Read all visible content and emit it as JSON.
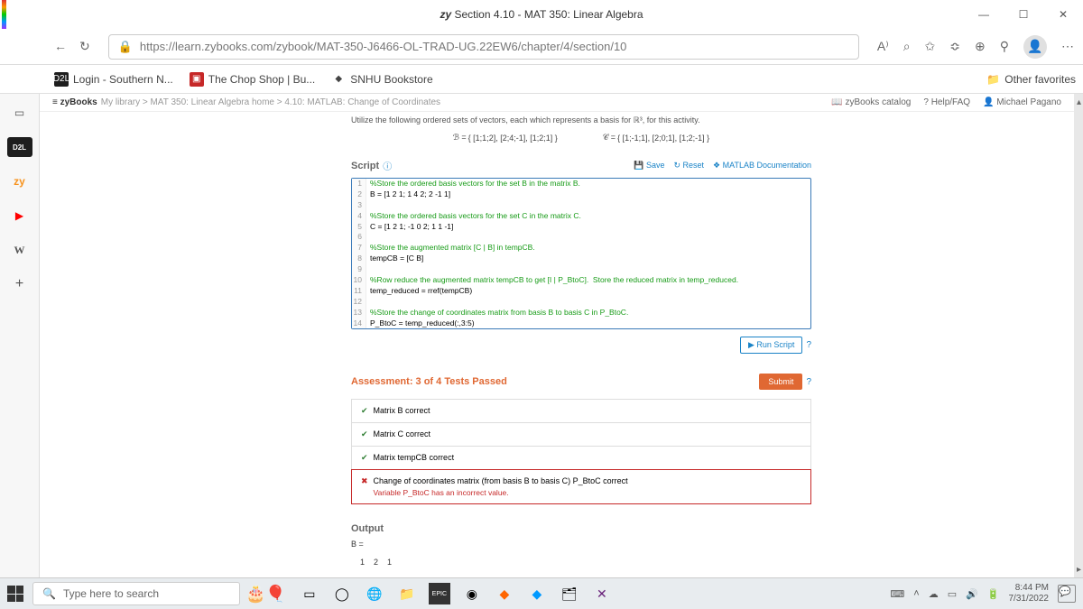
{
  "window": {
    "title_prefix": "zy",
    "title": "Section 4.10 - MAT 350: Linear Algebra"
  },
  "url": "https://learn.zybooks.com/zybook/MAT-350-J6466-OL-TRAD-UG.22EW6/chapter/4/section/10",
  "bookmarks": {
    "items": [
      {
        "label": "Login - Southern N..."
      },
      {
        "label": "The Chop Shop | Bu..."
      },
      {
        "label": "SNHU Bookstore"
      }
    ],
    "other": "Other favorites"
  },
  "zyheader": {
    "brand": "≡ zyBooks",
    "crumb": "My library > MAT 350: Linear Algebra home > 4.10: MATLAB: Change of Coordinates",
    "catalog": "zyBooks catalog",
    "help": "Help/FAQ",
    "user": "Michael Pagano"
  },
  "instruction": "Utilize the following ordered sets of vectors, each which represents a basis for ℝ³, for this activity.",
  "basis": {
    "b_label": "ℬ =",
    "b_vectors": "{ [1;1;2], [2;4;-1], [1;2;1] }",
    "c_label": "𝒞 =",
    "c_vectors": "{ [1;-1;1], [2;0;1], [1;2;-1] }"
  },
  "script": {
    "title": "Script",
    "save": "Save",
    "reset": "Reset",
    "docs": "MATLAB Documentation",
    "run": "Run Script",
    "lines": [
      {
        "n": "1",
        "cls": "code-comment",
        "t": "%Store the ordered basis vectors for the set B in the matrix B."
      },
      {
        "n": "2",
        "cls": "code-normal",
        "t": "B = [1 2 1; 1 4 2; 2 -1 1]"
      },
      {
        "n": "3",
        "cls": "code-normal",
        "t": ""
      },
      {
        "n": "4",
        "cls": "code-comment",
        "t": "%Store the ordered basis vectors for the set C in the matrix C."
      },
      {
        "n": "5",
        "cls": "code-normal",
        "t": "C = [1 2 1; -1 0 2; 1 1 -1]"
      },
      {
        "n": "6",
        "cls": "code-normal",
        "t": ""
      },
      {
        "n": "7",
        "cls": "code-comment",
        "t": "%Store the augmented matrix [C | B] in tempCB."
      },
      {
        "n": "8",
        "cls": "code-normal",
        "t": "tempCB = [C B]"
      },
      {
        "n": "9",
        "cls": "code-normal",
        "t": ""
      },
      {
        "n": "10",
        "cls": "code-comment",
        "t": "%Row reduce the augmented matrix tempCB to get [I | P_BtoC].  Store the reduced matrix in temp_reduced."
      },
      {
        "n": "11",
        "cls": "code-normal",
        "t": "temp_reduced = rref(tempCB)"
      },
      {
        "n": "12",
        "cls": "code-normal",
        "t": ""
      },
      {
        "n": "13",
        "cls": "code-comment",
        "t": "%Store the change of coordinates matrix from basis B to basis C in P_BtoC."
      },
      {
        "n": "14",
        "cls": "code-normal",
        "t": "P_BtoC = temp_reduced(:,3:5)"
      }
    ]
  },
  "assessment": {
    "title": "Assessment: 3 of 4 Tests Passed",
    "submit": "Submit",
    "tests": [
      {
        "pass": true,
        "label": "Matrix B correct"
      },
      {
        "pass": true,
        "label": "Matrix C correct"
      },
      {
        "pass": true,
        "label": "Matrix tempCB correct"
      },
      {
        "pass": false,
        "label": "Change of coordinates matrix (from basis B to basis C) P_BtoC correct",
        "msg": "Variable P_BtoC has an incorrect value."
      }
    ]
  },
  "output": {
    "title": "Output",
    "text": "B =\n\n    1    2    1"
  },
  "taskbar": {
    "search": "Type here to search",
    "time": "8:44 PM",
    "date": "7/31/2022"
  }
}
